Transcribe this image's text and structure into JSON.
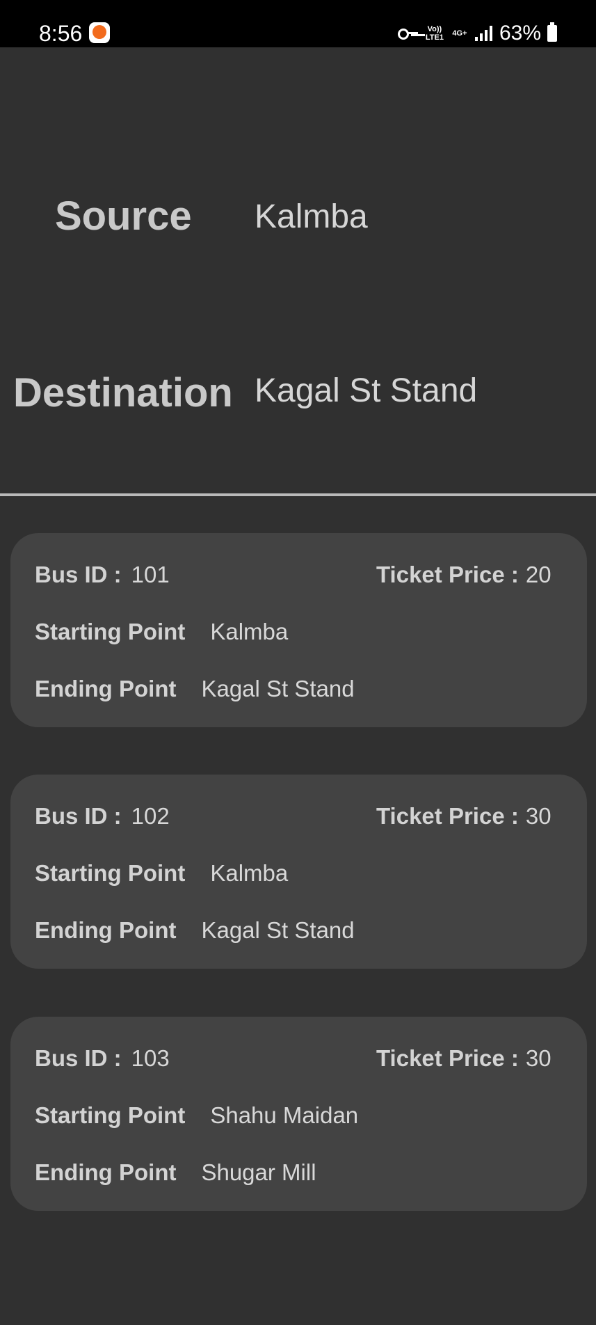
{
  "status_bar": {
    "time": "8:56",
    "volte": "Vo)) LTE1",
    "network": "4G+",
    "battery": "63%"
  },
  "route": {
    "source_label": "Source",
    "source_value": "Kalmba",
    "destination_label": "Destination",
    "destination_value": "Kagal St Stand"
  },
  "labels": {
    "bus_id": "Bus ID :",
    "ticket_price": "Ticket Price :",
    "starting_point": "Starting Point",
    "ending_point": "Ending Point"
  },
  "buses": [
    {
      "bus_id": "101",
      "ticket_price": "20",
      "starting_point": "Kalmba",
      "ending_point": "Kagal St Stand"
    },
    {
      "bus_id": "102",
      "ticket_price": "30",
      "starting_point": "Kalmba",
      "ending_point": "Kagal St Stand"
    },
    {
      "bus_id": "103",
      "ticket_price": "30",
      "starting_point": "Shahu Maidan",
      "ending_point": "Shugar Mill"
    }
  ],
  "colors": {
    "background": "#303030",
    "card": "#434343",
    "status_bar": "#000000",
    "divider": "#b9b9b9",
    "text": "#d6d6d6"
  }
}
